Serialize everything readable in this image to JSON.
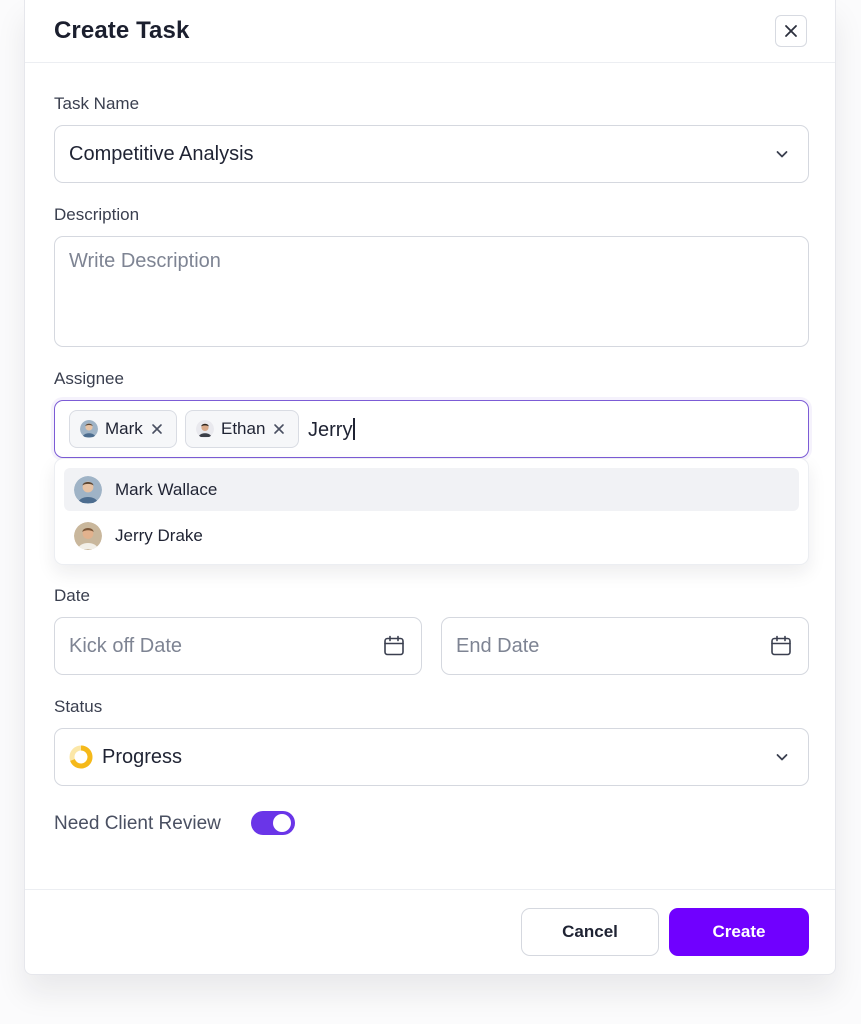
{
  "dialog": {
    "title": "Create Task"
  },
  "task_name": {
    "label": "Task Name",
    "value": "Competitive Analysis"
  },
  "description": {
    "label": "Description",
    "placeholder": "Write Description"
  },
  "assignee": {
    "label": "Assignee",
    "chips": [
      {
        "name": "Mark"
      },
      {
        "name": "Ethan"
      }
    ],
    "typed": "Jerry",
    "suggestions": [
      {
        "name": "Mark Wallace",
        "highlighted": true
      },
      {
        "name": "Jerry Drake",
        "highlighted": false
      }
    ]
  },
  "date": {
    "label": "Date",
    "start_placeholder": "Kick off Date",
    "end_placeholder": "End Date"
  },
  "status": {
    "label": "Status",
    "value": "Progress",
    "icon": "progress-ring-icon"
  },
  "client_review": {
    "label": "Need Client Review",
    "enabled": true
  },
  "footer": {
    "cancel_label": "Cancel",
    "create_label": "Create"
  },
  "colors": {
    "primary": "#7000ff",
    "toggle_on": "#6a35e8",
    "focus_border": "#7c5cd6",
    "status_progress": "#f5b91a"
  }
}
